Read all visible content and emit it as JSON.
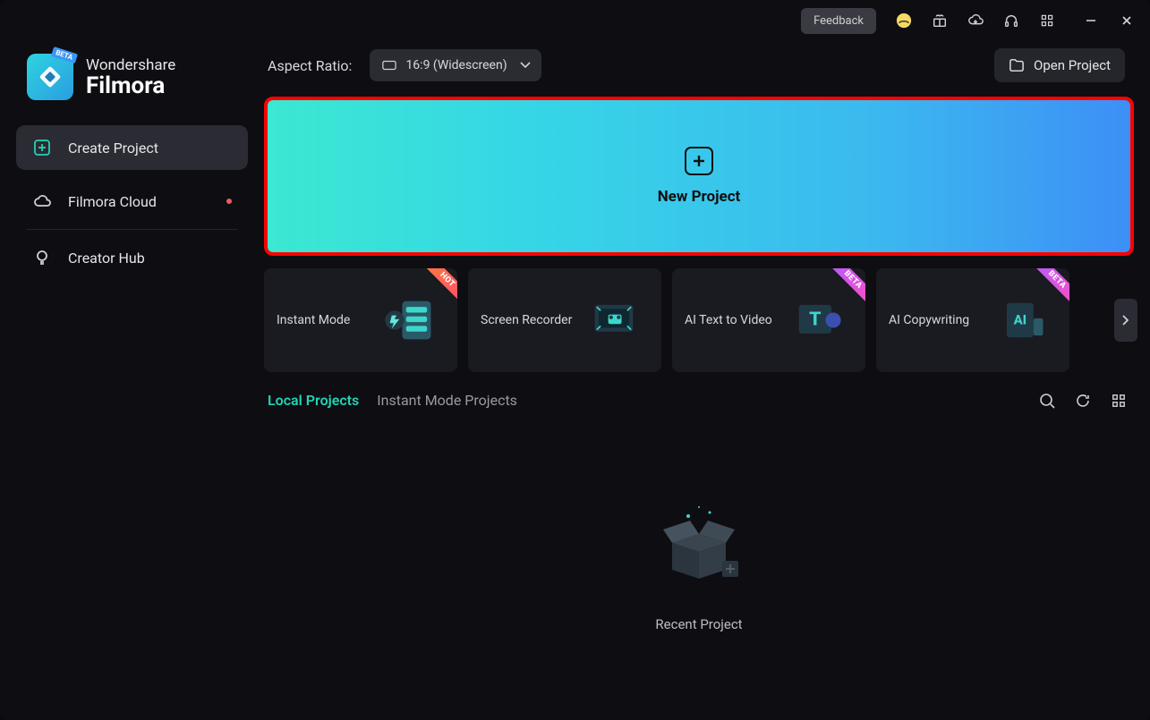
{
  "titlebar": {
    "feedback_label": "Feedback"
  },
  "brand": {
    "top": "Wondershare",
    "bottom": "Filmora",
    "logo_badge": "BETA"
  },
  "sidebar": {
    "items": [
      {
        "label": "Create Project",
        "icon": "plus-square",
        "active": true
      },
      {
        "label": "Filmora Cloud",
        "icon": "cloud",
        "active": false,
        "dot": true
      },
      {
        "label": "Creator Hub",
        "icon": "bulb",
        "active": false
      }
    ]
  },
  "toprow": {
    "aspect_label": "Aspect Ratio:",
    "aspect_value": "16:9 (Widescreen)",
    "open_project_label": "Open Project"
  },
  "new_project": {
    "label": "New Project"
  },
  "features": [
    {
      "label": "Instant Mode",
      "badge": "HOT",
      "badge_kind": "hot",
      "icon": "instant"
    },
    {
      "label": "Screen Recorder",
      "badge": null,
      "icon": "recorder"
    },
    {
      "label": "AI Text to Video",
      "badge": "BETA",
      "badge_kind": "beta",
      "icon": "text2video"
    },
    {
      "label": "AI Copywriting",
      "badge": "BETA",
      "badge_kind": "beta",
      "icon": "copywriting"
    }
  ],
  "tabs": {
    "items": [
      {
        "label": "Local Projects",
        "active": true
      },
      {
        "label": "Instant Mode Projects",
        "active": false
      }
    ]
  },
  "empty": {
    "label": "Recent Project"
  }
}
